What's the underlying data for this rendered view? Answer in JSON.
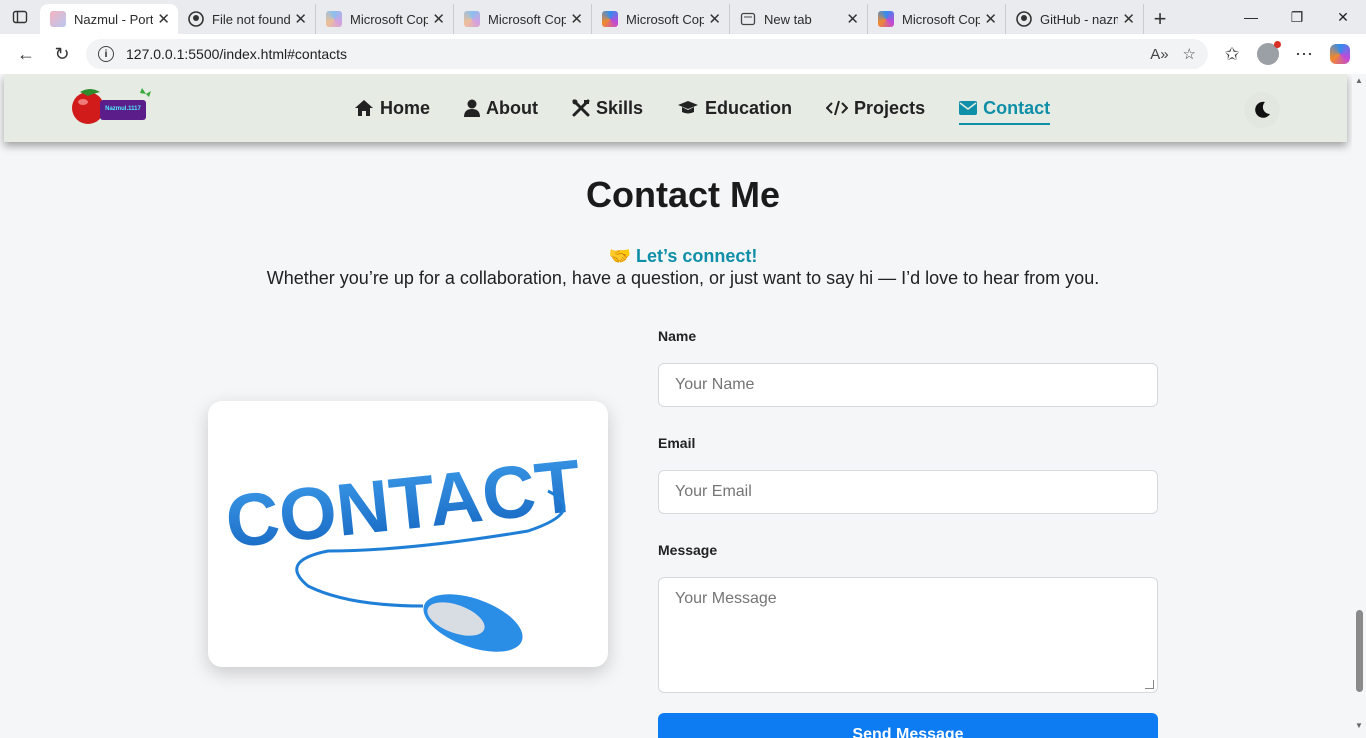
{
  "browser": {
    "tabs": [
      {
        "title": "Nazmul - Portf",
        "active": true,
        "icon": "site-favicon"
      },
      {
        "title": "File not found",
        "icon": "github-icon"
      },
      {
        "title": "Microsoft Cop",
        "icon": "copilot-icon"
      },
      {
        "title": "Microsoft Cop",
        "icon": "copilot-icon"
      },
      {
        "title": "Microsoft Cop",
        "icon": "copilot-icon"
      },
      {
        "title": "New tab",
        "icon": "newtab-icon"
      },
      {
        "title": "Microsoft Cop",
        "icon": "copilot-icon"
      },
      {
        "title": "GitHub - nazm",
        "icon": "github-icon"
      }
    ],
    "url": "127.0.0.1:5500/index.html#contacts"
  },
  "nav": {
    "logo_text": "Nazmul.1117",
    "items": [
      {
        "label": "Home",
        "icon": "home-icon"
      },
      {
        "label": "About",
        "icon": "user-icon"
      },
      {
        "label": "Skills",
        "icon": "tools-icon"
      },
      {
        "label": "Education",
        "icon": "graduation-cap-icon"
      },
      {
        "label": "Projects",
        "icon": "code-icon"
      },
      {
        "label": "Contact",
        "icon": "envelope-icon",
        "active": true
      }
    ],
    "theme_toggle_icon": "moon-icon"
  },
  "contact": {
    "heading": "Contact Me",
    "connect_emoji": "🤝",
    "connect_text": "Let’s connect!",
    "subtitle": "Whether you’re up for a collaboration, have a question, or just want to say hi — I’d love to hear from you.",
    "image_text": "CONTACT",
    "form": {
      "name_label": "Name",
      "name_placeholder": "Your Name",
      "email_label": "Email",
      "email_placeholder": "Your Email",
      "message_label": "Message",
      "message_placeholder": "Your Message",
      "submit_label": "Send Message"
    }
  },
  "colors": {
    "accent": "#0f8fa8",
    "button": "#0d7bf2",
    "navbar_bg": "#e6ebe4"
  }
}
